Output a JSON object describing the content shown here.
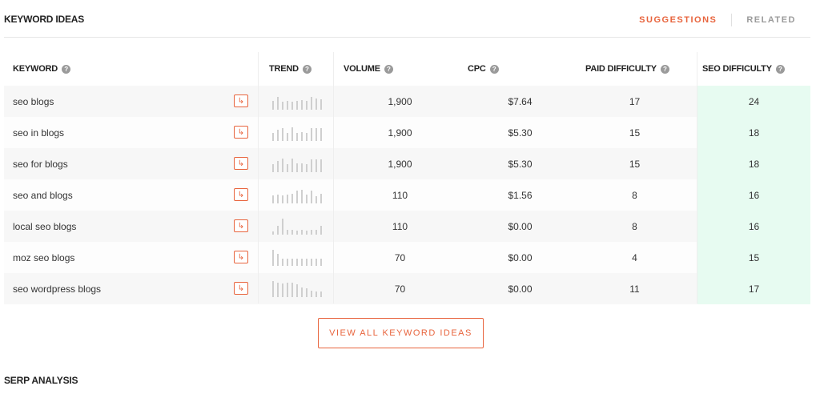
{
  "header": {
    "title": "KEYWORD IDEAS",
    "tabs": [
      {
        "label": "SUGGESTIONS",
        "active": true
      },
      {
        "label": "RELATED",
        "active": false
      }
    ]
  },
  "table": {
    "columns": {
      "keyword": "KEYWORD",
      "trend": "TREND",
      "volume": "VOLUME",
      "cpc": "CPC",
      "paid_difficulty": "PAID DIFFICULTY",
      "seo_difficulty": "SEO DIFFICULTY"
    },
    "help_icon": "help-circle-icon",
    "go_icon": "arrow-redirect-icon",
    "rows": [
      {
        "keyword": "seo blogs",
        "volume": "1,900",
        "cpc": "$7.64",
        "paid_difficulty": "17",
        "seo_difficulty": "24",
        "trend": [
          0.55,
          0.8,
          0.5,
          0.55,
          0.5,
          0.55,
          0.6,
          0.55,
          0.8,
          0.7,
          0.65
        ]
      },
      {
        "keyword": "seo in blogs",
        "volume": "1,900",
        "cpc": "$5.30",
        "paid_difficulty": "15",
        "seo_difficulty": "18",
        "trend": [
          0.5,
          0.7,
          0.8,
          0.5,
          0.85,
          0.5,
          0.55,
          0.5,
          0.8,
          0.8,
          0.8
        ]
      },
      {
        "keyword": "seo for blogs",
        "volume": "1,900",
        "cpc": "$5.30",
        "paid_difficulty": "15",
        "seo_difficulty": "18",
        "trend": [
          0.5,
          0.7,
          0.85,
          0.5,
          0.85,
          0.55,
          0.55,
          0.5,
          0.8,
          0.8,
          0.8
        ]
      },
      {
        "keyword": "seo and blogs",
        "volume": "110",
        "cpc": "$1.56",
        "paid_difficulty": "8",
        "seo_difficulty": "16",
        "trend": [
          0.5,
          0.55,
          0.5,
          0.55,
          0.6,
          0.8,
          0.85,
          0.55,
          0.8,
          0.45,
          0.6
        ]
      },
      {
        "keyword": "local seo blogs",
        "volume": "110",
        "cpc": "$0.00",
        "paid_difficulty": "8",
        "seo_difficulty": "16",
        "trend": [
          0.2,
          0.55,
          1.0,
          0.3,
          0.3,
          0.25,
          0.3,
          0.25,
          0.3,
          0.3,
          0.55
        ]
      },
      {
        "keyword": "moz seo blogs",
        "volume": "70",
        "cpc": "$0.00",
        "paid_difficulty": "4",
        "seo_difficulty": "15",
        "trend": [
          1.0,
          0.75,
          0.45,
          0.45,
          0.45,
          0.45,
          0.45,
          0.45,
          0.45,
          0.45,
          0.45
        ]
      },
      {
        "keyword": "seo wordpress blogs",
        "volume": "70",
        "cpc": "$0.00",
        "paid_difficulty": "11",
        "seo_difficulty": "17",
        "trend": [
          1.0,
          0.9,
          0.85,
          0.9,
          0.9,
          0.8,
          0.6,
          0.55,
          0.4,
          0.35,
          0.35
        ]
      }
    ]
  },
  "view_all_label": "VIEW ALL KEYWORD IDEAS",
  "serp_title": "SERP ANALYSIS",
  "colors": {
    "accent": "#e8643d",
    "seo_highlight": "#e7fbf1",
    "trend_bar": "#cfcfcf"
  }
}
